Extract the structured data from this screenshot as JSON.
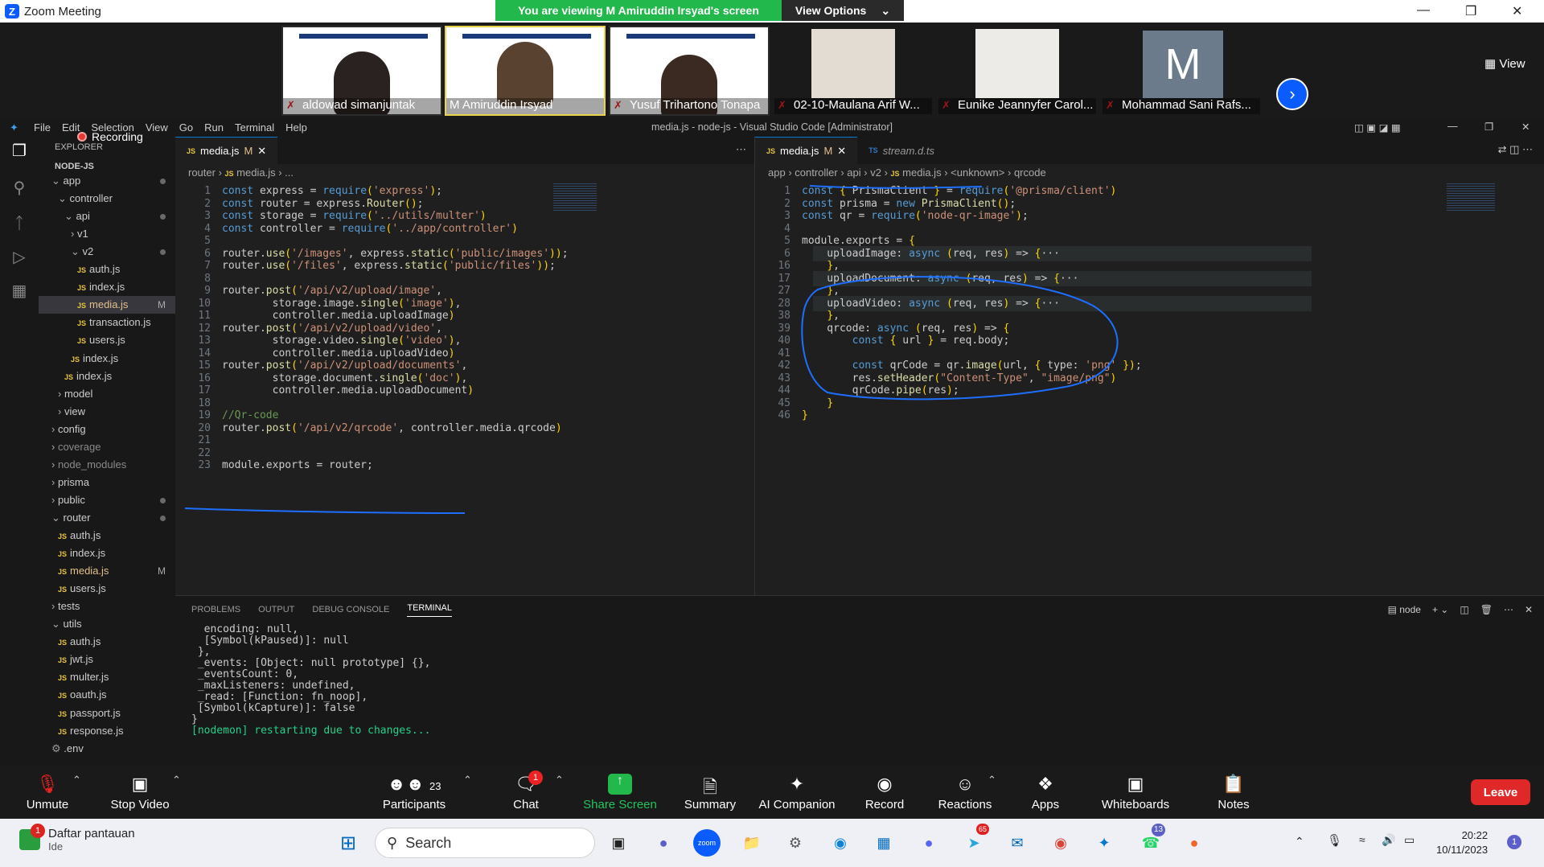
{
  "zoom": {
    "window_title": "Zoom Meeting",
    "banner": "You are viewing M Amiruddin Irsyad's screen",
    "view_options": "View Options",
    "view_label": "View",
    "participants_tiles": [
      {
        "name": "aldowad simanjuntak"
      },
      {
        "name": "M Amiruddin Irsyad"
      },
      {
        "name": "Yusuf Trihartono Tonapa"
      },
      {
        "name": "02-10-Maulana Arif W..."
      },
      {
        "name": "Eunike Jeannyfer Carol..."
      },
      {
        "name": "Mohammad Sani Rafs..."
      }
    ],
    "avatar_letter": "M",
    "controls": {
      "unmute": "Unmute",
      "stop_video": "Stop Video",
      "participants": "Participants",
      "participants_count": "23",
      "chat": "Chat",
      "chat_badge": "1",
      "share": "Share Screen",
      "summary": "Summary",
      "ai": "AI Companion",
      "record": "Record",
      "reactions": "Reactions",
      "apps": "Apps",
      "whiteboards": "Whiteboards",
      "notes": "Notes",
      "leave": "Leave"
    },
    "recording": "Recording"
  },
  "vscode": {
    "title": "media.js - node-js - Visual Studio Code [Administrator]",
    "menu": [
      "File",
      "Edit",
      "Selection",
      "View",
      "Go",
      "Run",
      "Terminal",
      "Help"
    ],
    "explorer_label": "EXPLORER",
    "root": "NODE-JS",
    "tree": [
      {
        "label": "app",
        "indent": 1,
        "kind": "folder-open",
        "dot": true
      },
      {
        "label": "controller",
        "indent": 2,
        "kind": "folder-open"
      },
      {
        "label": "api",
        "indent": 3,
        "kind": "folder-open",
        "dot": true
      },
      {
        "label": "v1",
        "indent": 4,
        "kind": "folder"
      },
      {
        "label": "v2",
        "indent": 4,
        "kind": "folder-open",
        "dot": true
      },
      {
        "label": "auth.js",
        "indent": 5,
        "kind": "js"
      },
      {
        "label": "index.js",
        "indent": 5,
        "kind": "js"
      },
      {
        "label": "media.js",
        "indent": 5,
        "kind": "js",
        "mod": "M",
        "selected": true
      },
      {
        "label": "transaction.js",
        "indent": 5,
        "kind": "js"
      },
      {
        "label": "users.js",
        "indent": 5,
        "kind": "js"
      },
      {
        "label": "index.js",
        "indent": 4,
        "kind": "js"
      },
      {
        "label": "index.js",
        "indent": 3,
        "kind": "js"
      },
      {
        "label": "model",
        "indent": 2,
        "kind": "folder"
      },
      {
        "label": "view",
        "indent": 2,
        "kind": "folder"
      },
      {
        "label": "config",
        "indent": 1,
        "kind": "folder"
      },
      {
        "label": "coverage",
        "indent": 1,
        "kind": "folder",
        "dim": true
      },
      {
        "label": "node_modules",
        "indent": 1,
        "kind": "folder",
        "dim": true
      },
      {
        "label": "prisma",
        "indent": 1,
        "kind": "folder"
      },
      {
        "label": "public",
        "indent": 1,
        "kind": "folder",
        "dot": true
      },
      {
        "label": "router",
        "indent": 1,
        "kind": "folder-open",
        "dot": true
      },
      {
        "label": "auth.js",
        "indent": 2,
        "kind": "js"
      },
      {
        "label": "index.js",
        "indent": 2,
        "kind": "js"
      },
      {
        "label": "media.js",
        "indent": 2,
        "kind": "js",
        "mod": "M"
      },
      {
        "label": "users.js",
        "indent": 2,
        "kind": "js"
      },
      {
        "label": "tests",
        "indent": 1,
        "kind": "folder"
      },
      {
        "label": "utils",
        "indent": 1,
        "kind": "folder-open"
      },
      {
        "label": "auth.js",
        "indent": 2,
        "kind": "js"
      },
      {
        "label": "jwt.js",
        "indent": 2,
        "kind": "js"
      },
      {
        "label": "multer.js",
        "indent": 2,
        "kind": "js"
      },
      {
        "label": "oauth.js",
        "indent": 2,
        "kind": "js"
      },
      {
        "label": "passport.js",
        "indent": 2,
        "kind": "js"
      },
      {
        "label": "response.js",
        "indent": 2,
        "kind": "js"
      },
      {
        "label": ".env",
        "indent": 1,
        "kind": "gear"
      }
    ],
    "editor_left": {
      "tab": "media.js",
      "tab_mod": "M",
      "breadcrumb": [
        "router",
        "media.js",
        "..."
      ],
      "lines": [
        {
          "n": "1",
          "code": "const express = require('express');"
        },
        {
          "n": "2",
          "code": "const router = express.Router();"
        },
        {
          "n": "3",
          "code": "const storage = require('../utils/multer')"
        },
        {
          "n": "4",
          "code": "const controller = require('../app/controller')"
        },
        {
          "n": "5",
          "code": ""
        },
        {
          "n": "6",
          "code": "router.use('/images', express.static('public/images'));"
        },
        {
          "n": "7",
          "code": "router.use('/files', express.static('public/files'));"
        },
        {
          "n": "8",
          "code": ""
        },
        {
          "n": "9",
          "code": "router.post('/api/v2/upload/image',"
        },
        {
          "n": "10",
          "code": "        storage.image.single('image'),"
        },
        {
          "n": "11",
          "code": "        controller.media.uploadImage)"
        },
        {
          "n": "12",
          "code": "router.post('/api/v2/upload/video',"
        },
        {
          "n": "13",
          "code": "        storage.video.single('video'),"
        },
        {
          "n": "14",
          "code": "        controller.media.uploadVideo)"
        },
        {
          "n": "15",
          "code": "router.post('/api/v2/upload/documents',"
        },
        {
          "n": "16",
          "code": "        storage.document.single('doc'),"
        },
        {
          "n": "17",
          "code": "        controller.media.uploadDocument)"
        },
        {
          "n": "18",
          "code": ""
        },
        {
          "n": "19",
          "code": "//Qr-code"
        },
        {
          "n": "20",
          "code": "router.post('/api/v2/qrcode', controller.media.qrcode)"
        },
        {
          "n": "21",
          "code": ""
        },
        {
          "n": "22",
          "code": ""
        },
        {
          "n": "23",
          "code": "module.exports = router;"
        }
      ]
    },
    "editor_right": {
      "tab": "media.js",
      "tab_mod": "M",
      "tab2": "stream.d.ts",
      "breadcrumb": [
        "app",
        "controller",
        "api",
        "v2",
        "media.js",
        "<unknown>",
        "qrcode"
      ],
      "lines": [
        {
          "n": "1",
          "code": "const { PrismaClient } = require('@prisma/client')"
        },
        {
          "n": "2",
          "code": "const prisma = new PrismaClient();"
        },
        {
          "n": "3",
          "code": "const qr = require('node-qr-image');"
        },
        {
          "n": "4",
          "code": ""
        },
        {
          "n": "5",
          "code": "module.exports = {"
        },
        {
          "n": "6",
          "code": "    uploadImage: async (req, res) => {···"
        },
        {
          "n": "16",
          "code": "    },"
        },
        {
          "n": "17",
          "code": "    uploadDocument: async (req, res) => {···"
        },
        {
          "n": "27",
          "code": "    },"
        },
        {
          "n": "28",
          "code": "    uploadVideo: async (req, res) => {···"
        },
        {
          "n": "38",
          "code": "    },"
        },
        {
          "n": "39",
          "code": "    qrcode: async (req, res) => {"
        },
        {
          "n": "40",
          "code": "        const { url } = req.body;"
        },
        {
          "n": "41",
          "code": ""
        },
        {
          "n": "42",
          "code": "        const qrCode = qr.image(url, { type: 'png' });"
        },
        {
          "n": "43",
          "code": "        res.setHeader(\"Content-Type\", \"image/png\")"
        },
        {
          "n": "44",
          "code": "        qrCode.pipe(res);"
        },
        {
          "n": "45",
          "code": "    }"
        },
        {
          "n": "46",
          "code": "}"
        }
      ]
    },
    "panel_tabs": [
      "PROBLEMS",
      "OUTPUT",
      "DEBUG CONSOLE",
      "TERMINAL"
    ],
    "terminal_shell": "node",
    "terminal": [
      "  encoding: null,",
      "  [Symbol(kPaused)]: null",
      " },",
      " _events: [Object: null prototype] {},",
      " _eventsCount: 0,",
      " _maxListeners: undefined,",
      " _read: [Function: fn_noop],",
      " [Symbol(kCapture)]: false",
      "}",
      "[nodemon] restarting due to changes..."
    ]
  },
  "taskbar": {
    "weather_title": "Daftar pantauan",
    "weather_sub": "Ide",
    "weather_badge": "1",
    "search": "Search",
    "telegram_badge": "65",
    "whatsapp_badge": "13",
    "time": "20:22",
    "date": "10/11/2023",
    "notif": "1"
  },
  "colors": {
    "zoom_green": "#22b84b",
    "zoom_blue": "#0b5cff",
    "leave_red": "#e02828",
    "vscode_accent": "#0078d4",
    "annotation_blue": "#1e6fff"
  }
}
